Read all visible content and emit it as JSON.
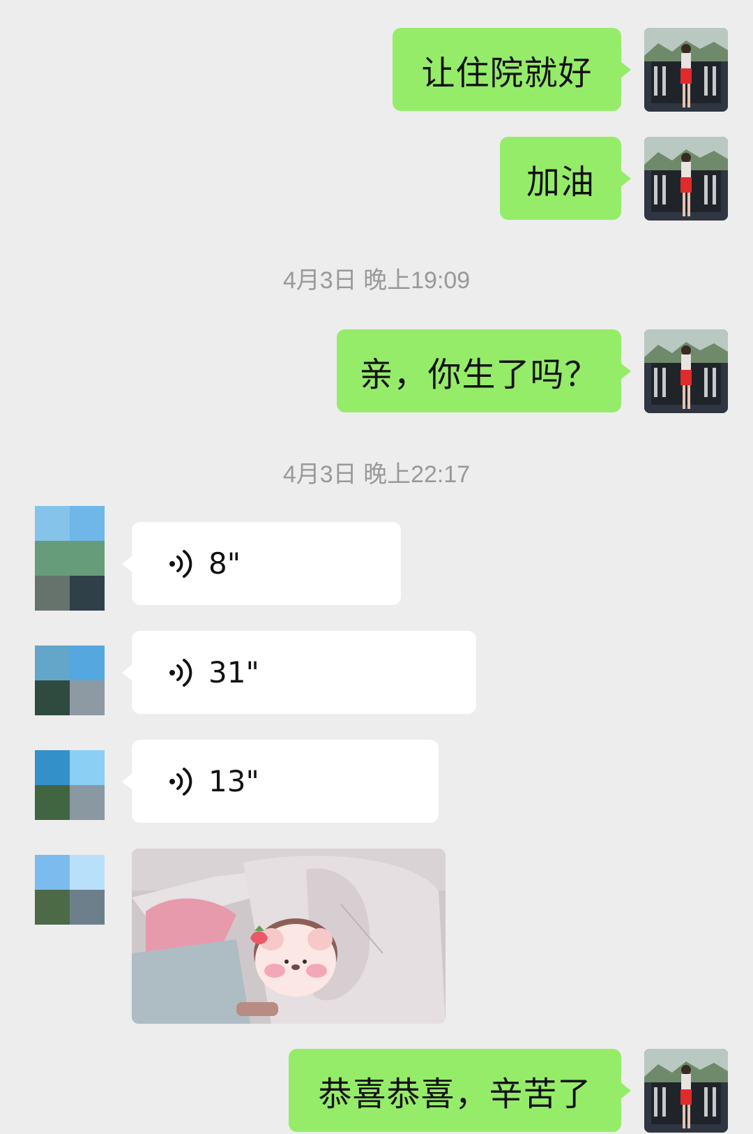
{
  "messages": {
    "m1": {
      "text": "让住院就好"
    },
    "m2": {
      "text": "加油"
    },
    "m3": {
      "text": "亲，你生了吗？"
    },
    "m4": {
      "text": "恭喜恭喜，辛苦了"
    }
  },
  "timestamps": {
    "t1": "4月3日 晚上19:09",
    "t2": "4月3日 晚上22:17"
  },
  "voice_messages": [
    {
      "duration": "8\""
    },
    {
      "duration": "31\""
    },
    {
      "duration": "13\""
    }
  ],
  "colors": {
    "background": "#ededed",
    "self_bubble": "#95ec69",
    "other_bubble": "#ffffff",
    "timestamp_text": "#999999"
  },
  "icons": {
    "voice": "voice-wave-icon"
  }
}
